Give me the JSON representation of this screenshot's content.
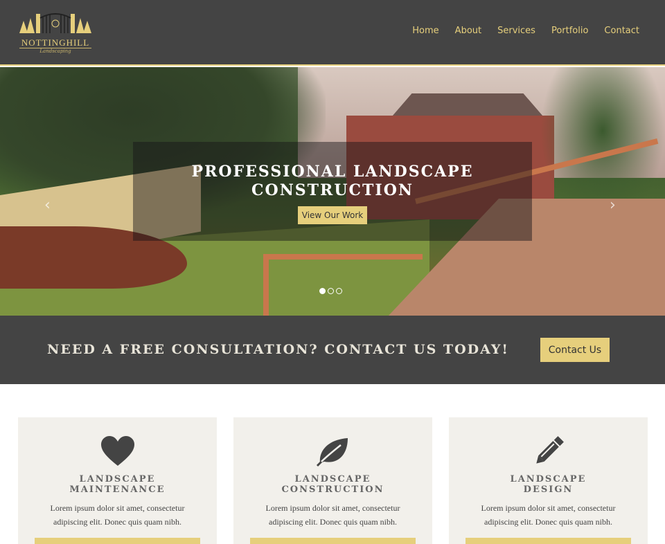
{
  "brand": {
    "name": "NOTTINGHILL",
    "tagline": "Landscaping",
    "accent_color": "#e6cf7c",
    "dark_color": "#444444"
  },
  "nav": {
    "items": [
      {
        "label": "Home"
      },
      {
        "label": "About"
      },
      {
        "label": "Services"
      },
      {
        "label": "Portfolio"
      },
      {
        "label": "Contact"
      }
    ]
  },
  "hero": {
    "title_line1": "PROFESSIONAL LANDSCAPE",
    "title_line2": "CONSTRUCTION",
    "button_label": "View Our Work",
    "prev_icon": "chevron-left-icon",
    "next_icon": "chevron-right-icon",
    "slides": 3,
    "active_slide": 1
  },
  "cta": {
    "text": "NEED A FREE CONSULTATION? CONTACT US TODAY!",
    "button_label": "Contact Us"
  },
  "services": [
    {
      "icon": "heart-icon",
      "title_line1": "LANDSCAPE",
      "title_line2": "MAINTENANCE",
      "text": "Lorem ipsum dolor sit amet, consectetur adipiscing elit. Donec quis quam nibh."
    },
    {
      "icon": "leaf-icon",
      "title_line1": "LANDSCAPE",
      "title_line2": "CONSTRUCTION",
      "text": "Lorem ipsum dolor sit amet, consectetur adipiscing elit. Donec quis quam nibh."
    },
    {
      "icon": "pencil-icon",
      "title_line1": "LANDSCAPE",
      "title_line2": "DESIGN",
      "text": "Lorem ipsum dolor sit amet, consectetur adipiscing elit. Donec quis quam nibh."
    }
  ]
}
